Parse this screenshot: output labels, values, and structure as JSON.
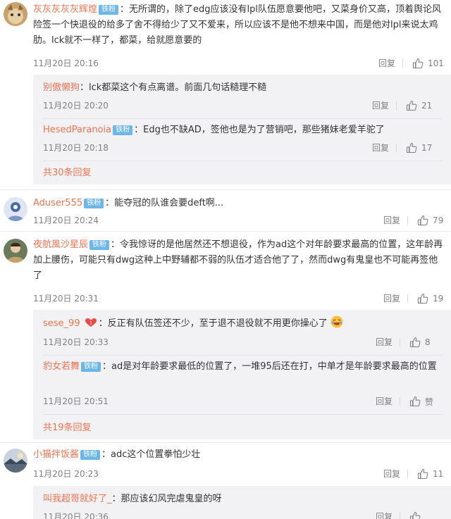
{
  "c1": {
    "user": "灰灰灰灰灰辉煌",
    "badge": "铁粉",
    "text": "：无所谓的，除了edg应该没有lpl队伍愿意要他吧，又菜身价又高，顶着舆论风险签一个快退役的给多了舍不得给少了又不爱来，所以应该不是他不想来中国，而是他对lpl来说太鸡肋。lck就不一样了，都菜，给就愿意要的",
    "time": "11月20日 20:16",
    "reply": "回复",
    "likes": "101",
    "subs": [
      {
        "user": "别傲懒狗",
        "text": "：lck都菜这个有点离谱。前面几句话糙理不糙",
        "time": "11月20日 20:20",
        "reply": "回复",
        "likes": "21"
      },
      {
        "user": "HesedParanoia",
        "badge": "铁粉",
        "text": "：Edg也不缺AD，签他也是为了营销吧，那些猪妹老爱羊驼了",
        "time": "11月20日 20:18",
        "reply": "回复",
        "likes": "17"
      }
    ],
    "more": "共30条回复"
  },
  "c2": {
    "user": "Aduser555",
    "badge": "铁粉",
    "text": "：能夺冠的队谁会要deft啊...",
    "time": "11月20日 20:24",
    "reply": "回复",
    "likes": "79"
  },
  "c3": {
    "user": "夜航風沙星辰",
    "badge": "铁粉",
    "text": "：令我惊讶的是他居然还不想退役，作为ad这个对年龄要求最高的位置，这年龄再加上腰伤，可能只有dwg这种上中野辅都不弱的队伍才适合他了了，然而dwg有鬼皇也不可能再签他了",
    "time": "11月20日 20:31",
    "reply": "回复",
    "likes": "19",
    "subs": [
      {
        "user": "sese_99",
        "text": "：反正有队伍签还不少，至于退不退役就不用更你操心了",
        "time": "11月20日 20:33",
        "reply": "回复",
        "likes": "8"
      },
      {
        "user": "豹女若舞",
        "badge": "铁粉",
        "text": "：ad是对年龄要求最低的位置了，一堆95后还在打，中单才是年龄要求最高的位置",
        "time": "11月20日 20:51",
        "reply": "回复",
        "likes": "赞"
      }
    ],
    "more": "共19条回复"
  },
  "c4": {
    "user": "小猫拌饭酱",
    "badge": "铁粉",
    "text": "：adc这个位置拳怕少壮",
    "time": "11月20日 20:23",
    "reply": "回复",
    "likes": "11",
    "subs": [
      {
        "user": "叫我超哥就好了_",
        "text": "：那应该幻风完虐鬼皇的呀",
        "time": "11月20日 20:36",
        "reply": "回复",
        "likes": ""
      }
    ]
  },
  "colors": {
    "username": "#eb7350",
    "badge": "#6db6e8",
    "subbox": "#f2f2f5",
    "meta": "#808080"
  }
}
